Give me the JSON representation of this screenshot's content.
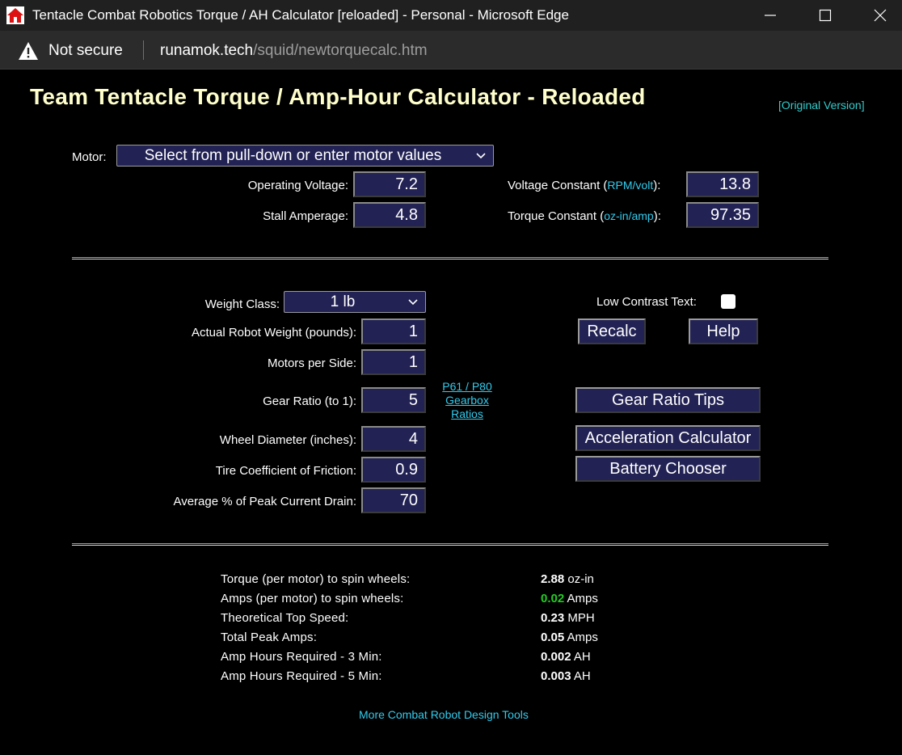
{
  "window": {
    "title": "Tentacle Combat Robotics Torque / AH Calculator [reloaded] - Personal - Microsoft Edge"
  },
  "address_bar": {
    "security_label": "Not secure",
    "url_host": "runamok.tech",
    "url_path": "/squid/newtorquecalc.htm"
  },
  "page": {
    "title": "Team Tentacle Torque / Amp-Hour Calculator - Reloaded",
    "original_version_link": "[Original Version]"
  },
  "motor": {
    "label": "Motor:",
    "select_value": "Select from pull-down or enter motor values",
    "operating_voltage_label": "Operating Voltage:",
    "operating_voltage": "7.2",
    "stall_amperage_label": "Stall Amperage:",
    "stall_amperage": "4.8",
    "voltage_constant_label": "Voltage Constant (",
    "voltage_constant_unit": "RPM/volt",
    "voltage_constant_close": "):",
    "voltage_constant": "13.8",
    "torque_constant_label": "Torque Constant (",
    "torque_constant_unit": "oz-in/amp",
    "torque_constant_close": "):",
    "torque_constant": "97.35"
  },
  "robot": {
    "weight_class_label": "Weight Class:",
    "weight_class": "1 lb",
    "actual_weight_label": "Actual Robot Weight (pounds):",
    "actual_weight": "1",
    "motors_per_side_label": "Motors per Side:",
    "motors_per_side": "1",
    "gear_ratio_label": "Gear Ratio (to 1):",
    "gear_ratio": "5",
    "gearbox_link": [
      "P61 / P80",
      "Gearbox",
      "Ratios"
    ],
    "wheel_diameter_label": "Wheel Diameter (inches):",
    "wheel_diameter": "4",
    "tire_cof_label": "Tire Coefficient of Friction:",
    "tire_cof": "0.9",
    "avg_peak_label": "Average % of Peak Current Drain:",
    "avg_peak": "70"
  },
  "controls": {
    "low_contrast_label": "Low Contrast Text:",
    "recalc": "Recalc",
    "help": "Help",
    "gear_ratio_tips": "Gear Ratio Tips",
    "acceleration_calculator": "Acceleration Calculator",
    "battery_chooser": "Battery Chooser"
  },
  "results": [
    {
      "label": "Torque (per motor) to spin wheels:",
      "value": "2.88",
      "unit": "oz-in",
      "highlight": false
    },
    {
      "label": "Amps (per motor) to spin wheels:",
      "value": "0.02",
      "unit": "Amps",
      "highlight": true
    },
    {
      "label": "Theoretical Top Speed:",
      "value": "0.23",
      "unit": "MPH",
      "highlight": false
    },
    {
      "label": "Total Peak Amps:",
      "value": "0.05",
      "unit": "Amps",
      "highlight": false
    },
    {
      "label": "Amp Hours Required - 3 Min:",
      "value": "0.002",
      "unit": "AH",
      "highlight": false
    },
    {
      "label": "Amp Hours Required - 5 Min:",
      "value": "0.003",
      "unit": "AH",
      "highlight": false
    }
  ],
  "footer": {
    "more_tools_link": "More Combat Robot Design Tools"
  },
  "colors": {
    "title_yellow": "#ffffcc",
    "link_cyan": "#33ccee",
    "field_bg": "#222255",
    "highlight_green": "#22cc22"
  }
}
